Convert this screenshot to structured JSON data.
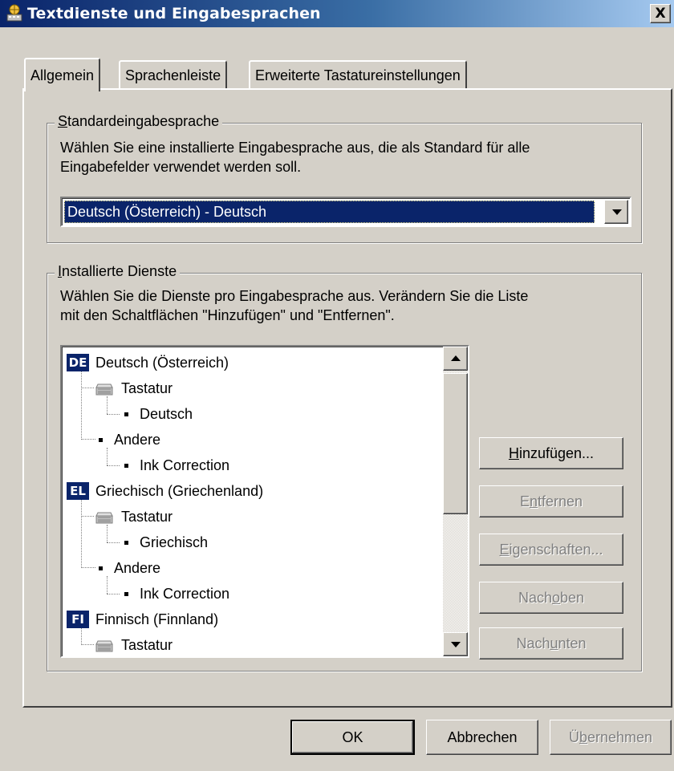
{
  "window": {
    "title": "Textdienste und Eingabesprachen",
    "close_symbol": "X"
  },
  "tabs": [
    {
      "label": "Allgemein",
      "active": true
    },
    {
      "label": "Sprachenleiste",
      "active": false
    },
    {
      "label": "Erweiterte Tastatureinstellungen",
      "active": false
    }
  ],
  "default_language": {
    "group_label_mnemonic": "S",
    "group_label_rest": "tandardeingabesprache",
    "description_line1": "Wählen Sie eine installierte Eingabesprache aus, die als Standard für alle",
    "description_line2": "Eingabefelder verwendet werden soll.",
    "selected_value": "Deutsch (Österreich) - Deutsch"
  },
  "installed_services": {
    "group_label_mnemonic": "I",
    "group_label_rest": "nstallierte Dienste",
    "description_line1": "Wählen Sie die Dienste pro Eingabesprache aus. Verändern Sie die Liste",
    "description_line2": "mit den Schaltflächen \"Hinzufügen\" und \"Entfernen\".",
    "tree": [
      {
        "type": "language",
        "badge": "DE",
        "label": "Deutsch (Österreich)"
      },
      {
        "type": "category",
        "icon": "keyboard-icon",
        "label": "Tastatur"
      },
      {
        "type": "service",
        "label": "Deutsch"
      },
      {
        "type": "category",
        "icon": "bullet",
        "label": "Andere"
      },
      {
        "type": "service",
        "label": "Ink Correction"
      },
      {
        "type": "language",
        "badge": "EL",
        "label": "Griechisch (Griechenland)"
      },
      {
        "type": "category",
        "icon": "keyboard-icon",
        "label": "Tastatur"
      },
      {
        "type": "service",
        "label": "Griechisch"
      },
      {
        "type": "category",
        "icon": "bullet",
        "label": "Andere"
      },
      {
        "type": "service",
        "label": "Ink Correction"
      },
      {
        "type": "language",
        "badge": "FI",
        "label": "Finnisch (Finnland)"
      },
      {
        "type": "category",
        "icon": "keyboard-icon",
        "label": "Tastatur"
      }
    ],
    "buttons": {
      "add": {
        "pre": "",
        "mn": "H",
        "post": "inzufügen...",
        "enabled": true
      },
      "remove": {
        "pre": "E",
        "mn": "n",
        "post": "tfernen",
        "enabled": false
      },
      "properties": {
        "pre": "",
        "mn": "E",
        "post": "igenschaften...",
        "enabled": false
      },
      "move_up": {
        "pre": "Nach ",
        "mn": "o",
        "post": "ben",
        "enabled": false
      },
      "move_down": {
        "pre": "Nach ",
        "mn": "u",
        "post": "nten",
        "enabled": false
      }
    }
  },
  "footer": {
    "ok": "OK",
    "cancel": "Abbrechen",
    "apply_pre": "Ü",
    "apply_mn": "b",
    "apply_post": "ernehmen"
  }
}
